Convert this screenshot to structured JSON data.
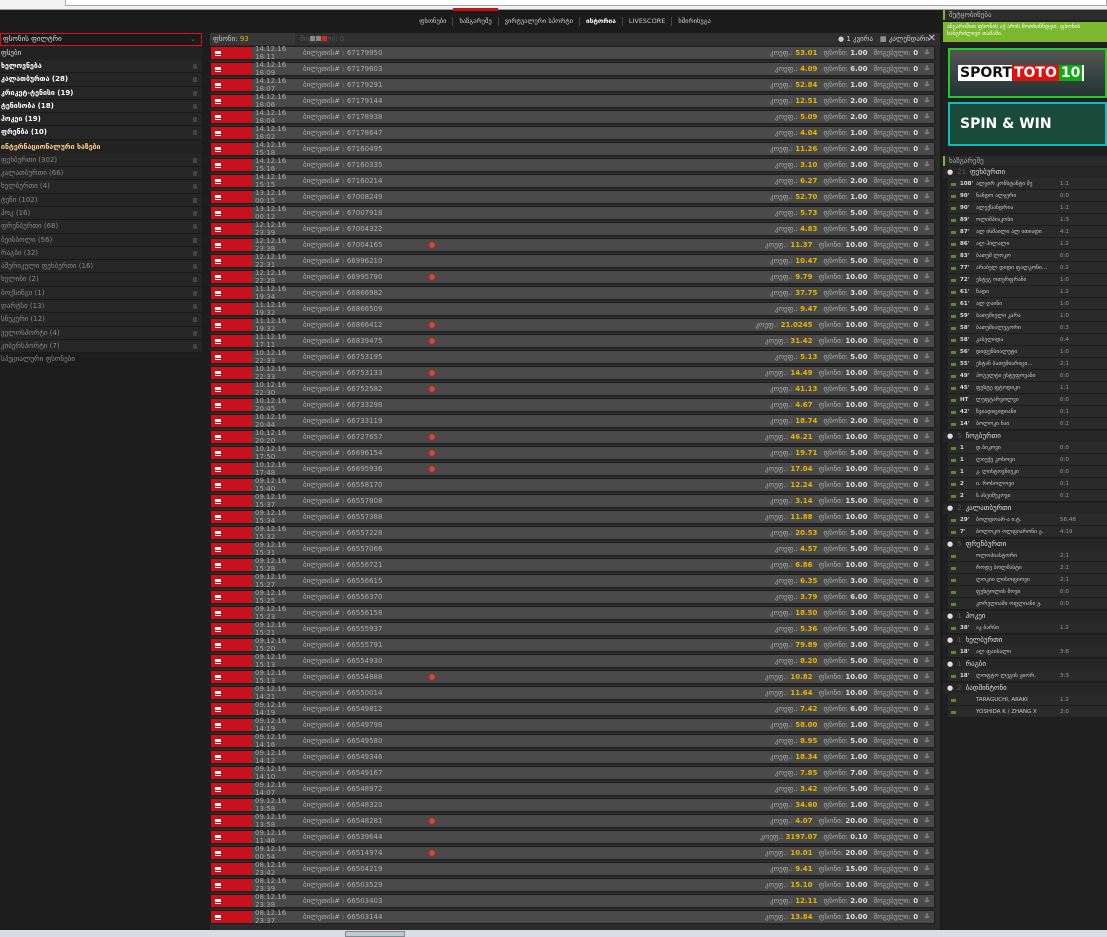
{
  "nav": {
    "items": [
      "ფსონები",
      "ხაზგარეშე",
      "ვირტუალური სპორტი",
      "ისტორია",
      "LIVESCORE",
      "ხშირიხვგა"
    ]
  },
  "sidebar": {
    "filter": "ფსონის ფილტრი",
    "head1": "ფსები",
    "items1": [
      "ხელოვნება",
      "კალათბურთა (28)",
      "კრიკეტ-ტენისი (19)",
      "ტენისობა (18)",
      "ჰოკეი (19)",
      "ფრენბა (10)"
    ],
    "head2": "ინტერნაციონალური ხაზები",
    "items2": [
      "ფეხბურთი (302)",
      "კალათბურთი (66)",
      "ხელბურთი (4)",
      "ტენი (102)",
      "ჰოკ (16)",
      "ფრენბურთი (68)",
      "ბეისბოლი (56)",
      "რაგბი (32)",
      "ამერიკული ფეხბურთი (16)",
      "ხელიბი (2)",
      "ბოქსინგი (1)",
      "დარტსი (13)",
      "სნუკერი (12)",
      "ველოსპორტი (4)",
      "კიბერსპორტი (7)",
      "სპეციალური ფსონები"
    ]
  },
  "history": {
    "count_label": "ფსონი:",
    "count": "93",
    "won_label": "მოგებული: 0",
    "period": "1 კვირა",
    "calendar": "კალენდარი",
    "close": "✕",
    "ticket_label": "ბილეთის# :",
    "coef_label": "კოეფ.:",
    "stake_label": "ფსონი:",
    "win_label": "მოგებული:",
    "rows": [
      [
        "14.12.16 18:11",
        "67179950",
        "53.01",
        "1.00",
        "0",
        false
      ],
      [
        "14.12.16 18:09",
        "67179603",
        "4.09",
        "6.00",
        "0",
        false
      ],
      [
        "14.12.16 18:07",
        "67179291",
        "52.84",
        "1.00",
        "0",
        false
      ],
      [
        "14.12.16 18:06",
        "67179144",
        "12.51",
        "2.00",
        "0",
        false
      ],
      [
        "14.12.16 18:04",
        "67178938",
        "5.09",
        "2.00",
        "0",
        false
      ],
      [
        "14.12.16 18:02",
        "67178647",
        "4.04",
        "1.00",
        "0",
        false
      ],
      [
        "14.12.16 15:18",
        "67160495",
        "11.26",
        "2.00",
        "0",
        false
      ],
      [
        "14.12.16 15:16",
        "67160335",
        "3.10",
        "3.00",
        "0",
        false
      ],
      [
        "14.12.16 15:15",
        "67160214",
        "6.27",
        "2.00",
        "0",
        false
      ],
      [
        "13.12.16 00:15",
        "67008249",
        "52.70",
        "1.00",
        "0",
        false
      ],
      [
        "13.12.16 00:12",
        "67007918",
        "5.73",
        "5.00",
        "0",
        false
      ],
      [
        "12.12.16 23:39",
        "67004322",
        "4.83",
        "5.00",
        "0",
        false
      ],
      [
        "12.12.16 23:38",
        "67004165",
        "11.37",
        "10.00",
        "0",
        true
      ],
      [
        "12.12.16 22:31",
        "66996210",
        "10.47",
        "5.00",
        "0",
        false
      ],
      [
        "12.12.16 22:28",
        "66995790",
        "9.79",
        "10.00",
        "0",
        true
      ],
      [
        "11.12.16 19:34",
        "66866982",
        "37.75",
        "3.00",
        "0",
        false
      ],
      [
        "11.12.16 19:32",
        "66866509",
        "9.47",
        "5.00",
        "0",
        false
      ],
      [
        "11.12.16 19:32",
        "66866412",
        "21.0245",
        "10.00",
        "0",
        true
      ],
      [
        "11.12.16 17:11",
        "66839475",
        "31.42",
        "10.00",
        "0",
        true
      ],
      [
        "10.12.16 22:33",
        "66753195",
        "5.13",
        "5.00",
        "0",
        false
      ],
      [
        "10.12.16 22:33",
        "66753133",
        "14.49",
        "10.00",
        "0",
        true
      ],
      [
        "10.12.16 22:30",
        "66752582",
        "41.13",
        "5.00",
        "0",
        true
      ],
      [
        "10.12.16 20:45",
        "66733298",
        "4.67",
        "10.00",
        "0",
        false
      ],
      [
        "10.12.16 20:44",
        "66733119",
        "18.74",
        "2.00",
        "0",
        false
      ],
      [
        "10.12.16 20:20",
        "66727657",
        "46.21",
        "10.00",
        "0",
        true
      ],
      [
        "10.12.16 17:50",
        "66696154",
        "19.71",
        "5.00",
        "0",
        true
      ],
      [
        "10.12.16 17:48",
        "66695936",
        "17.04",
        "10.00",
        "0",
        true
      ],
      [
        "09.12.16 15:40",
        "66558170",
        "12.24",
        "10.00",
        "0",
        false
      ],
      [
        "09.12.16 15:37",
        "66557808",
        "3.14",
        "15.00",
        "0",
        false
      ],
      [
        "09.12.16 15:34",
        "66557388",
        "11.88",
        "10.00",
        "0",
        false
      ],
      [
        "09.12.16 15:32",
        "66557228",
        "20.53",
        "5.00",
        "0",
        false
      ],
      [
        "09.12.16 15:31",
        "66557066",
        "4.57",
        "5.00",
        "0",
        false
      ],
      [
        "09.12.16 15:28",
        "66556721",
        "6.86",
        "10.00",
        "0",
        false
      ],
      [
        "09.12.16 15:27",
        "66556615",
        "6.35",
        "3.00",
        "0",
        false
      ],
      [
        "09.12.16 15:25",
        "66556370",
        "3.79",
        "6.00",
        "0",
        false
      ],
      [
        "09.12.16 15:23",
        "66556158",
        "18.50",
        "3.00",
        "0",
        false
      ],
      [
        "09.12.16 15:21",
        "66555937",
        "5.36",
        "5.00",
        "0",
        false
      ],
      [
        "09.12.16 15:20",
        "66555791",
        "79.89",
        "3.00",
        "0",
        false
      ],
      [
        "09.12.16 15:13",
        "66554930",
        "8.20",
        "5.00",
        "0",
        false
      ],
      [
        "09.12.16 15:13",
        "66554888",
        "10.82",
        "10.00",
        "0",
        true
      ],
      [
        "09.12.16 14:21",
        "66550014",
        "11.64",
        "10.00",
        "0",
        false
      ],
      [
        "09.12.16 14:19",
        "66549812",
        "7.42",
        "6.00",
        "0",
        false
      ],
      [
        "09.12.16 14:19",
        "66549798",
        "58.00",
        "1.00",
        "0",
        false
      ],
      [
        "09.12.16 14:16",
        "66549580",
        "8.95",
        "5.00",
        "0",
        false
      ],
      [
        "09.12.16 14:12",
        "66549346",
        "18.34",
        "1.00",
        "0",
        false
      ],
      [
        "09.12.16 14:10",
        "66549167",
        "7.85",
        "7.00",
        "0",
        false
      ],
      [
        "09.12.16 14:07",
        "66548972",
        "3.42",
        "5.00",
        "0",
        false
      ],
      [
        "09.12.16 13:58",
        "66548320",
        "34.60",
        "1.00",
        "0",
        false
      ],
      [
        "09.12.16 13:58",
        "66548281",
        "4.07",
        "20.00",
        "0",
        true
      ],
      [
        "09.12.16 11:46",
        "66539644",
        "3197.07",
        "0.10",
        "0",
        false
      ],
      [
        "09.12.16 00:54",
        "66514974",
        "10.01",
        "20.00",
        "0",
        true
      ],
      [
        "08.12.16 23:42",
        "66504219",
        "9.41",
        "15.00",
        "0",
        false
      ],
      [
        "08.12.16 23:39",
        "66503529",
        "15.10",
        "10.00",
        "0",
        false
      ],
      [
        "08.12.16 23:38",
        "66503403",
        "12.11",
        "2.00",
        "0",
        false
      ],
      [
        "08.12.16 23:37",
        "66503144",
        "13.84",
        "10.00",
        "0",
        false
      ]
    ]
  },
  "right": {
    "msg_title": "შეტყობინება",
    "msg": "ანგარიშით ფსონის აქ არის მოთხიწნდეთ. ფსონის ხანგრძლივი თამაში.",
    "banner1": {
      "a": "SPORT",
      "b": "TOTO",
      "c": "10"
    },
    "banner2": "SPIN & WIN",
    "live_title": "ხაზგარეშე",
    "sports": [
      {
        "name": "ფეხბურთი",
        "count": "21",
        "events": [
          [
            "108'",
            "ალჟირ კონსტანტი შე",
            "1:1"
          ],
          [
            "90'",
            "ნანდო ალჯერი",
            "0:0"
          ],
          [
            "90'",
            "ალექსანდრია",
            "1:1"
          ],
          [
            "89'",
            "ოლიმპიაკოსი",
            "1:3"
          ],
          [
            "87'",
            "ალ ისმაილი ალ ითიადი",
            "4:1"
          ],
          [
            "86'",
            "ალ ჰილალი",
            "1:2"
          ],
          [
            "83'",
            "ბათუმ ლოკო",
            "0:0"
          ],
          [
            "77'",
            "არაბულ დიდი ფალკონი...",
            "0:2"
          ],
          [
            "72'",
            "ესტეგ ოთერფრანი",
            "1:0"
          ],
          [
            "61'",
            "ჩადი",
            "1:2"
          ],
          [
            "61'",
            "ალ ღაინი",
            "1:0"
          ],
          [
            "59'",
            "ბათუმიელი კარა",
            "1:0"
          ],
          [
            "58'",
            "ბათუმიალუგორი",
            "0:3"
          ],
          [
            "58'",
            "კასელიდა",
            "0:4"
          ],
          [
            "56'",
            "დიფენსიალუტი",
            "1:0"
          ],
          [
            "55'",
            "ესტან ბათუმიარიცი...",
            "2:1"
          ],
          [
            "49'",
            "ჰოგელტი ესტუფოვანი",
            "0:0"
          ],
          [
            "45'",
            "ფუხტე ფტოდიკი",
            "1:1"
          ],
          [
            "HT",
            "ლუფტარვოლვი",
            "0:0"
          ],
          [
            "42'",
            "ზვიადიციდიანი",
            "0:1"
          ],
          [
            "14'",
            "ბოლოკი ხაი",
            "0:1"
          ]
        ]
      },
      {
        "name": "ჩოგბურთი",
        "count": "5",
        "events": [
          [
            "1",
            "დ.ბიკოვი",
            "0:0"
          ],
          [
            "1",
            "ლიუქვ კოსოვი",
            "0:0"
          ],
          [
            "1",
            "კ. ლისტოვნიუკი",
            "0:0"
          ],
          [
            "2",
            "ი. როსოლოვი",
            "0:1"
          ],
          [
            "2",
            "ს.ასეიმუკოვი",
            "0:1"
          ]
        ]
      },
      {
        "name": "კალათბურთი",
        "count": "2",
        "events": [
          [
            "29'",
            "ბოლდოარ-ა ი.ტ.",
            "56:48"
          ],
          [
            "7'",
            "ბოლოკო ოლფიარონი ჟ.",
            "4:19"
          ]
        ]
      },
      {
        "name": "ფრენბურთი",
        "count": "5",
        "events": [
          [
            "",
            "ოლოპიასტორი",
            "2:1"
          ],
          [
            "",
            "როდე ბოლმასტი",
            "2:1"
          ],
          [
            "",
            "ლოკიი ლისოფიოვი",
            "2:1"
          ],
          [
            "",
            "ფუხტოლის მოვი",
            "0:0"
          ],
          [
            "",
            "კორელიამი ოფლიანი ჟ.",
            "0:0"
          ]
        ]
      },
      {
        "name": "ჰოკეი",
        "count": "1",
        "events": [
          [
            "38'",
            "აკ ბარსი",
            "1:2"
          ]
        ]
      },
      {
        "name": "ხელბურთი",
        "count": "1",
        "events": [
          [
            "18'",
            "ალ ფაისალი",
            "3:8"
          ]
        ]
      },
      {
        "name": "რაგბი",
        "count": "1",
        "events": [
          [
            "18'",
            "ლოფტო ლეგის ჟიორ.",
            "3:3"
          ]
        ]
      },
      {
        "name": "ბადმინტონი",
        "count": "2",
        "events": [
          [
            "",
            "TARAGUCHI, ARAKI",
            "1:2"
          ],
          [
            "",
            "YOSHIDA K / ZHANG X",
            "2:0"
          ]
        ]
      }
    ]
  }
}
